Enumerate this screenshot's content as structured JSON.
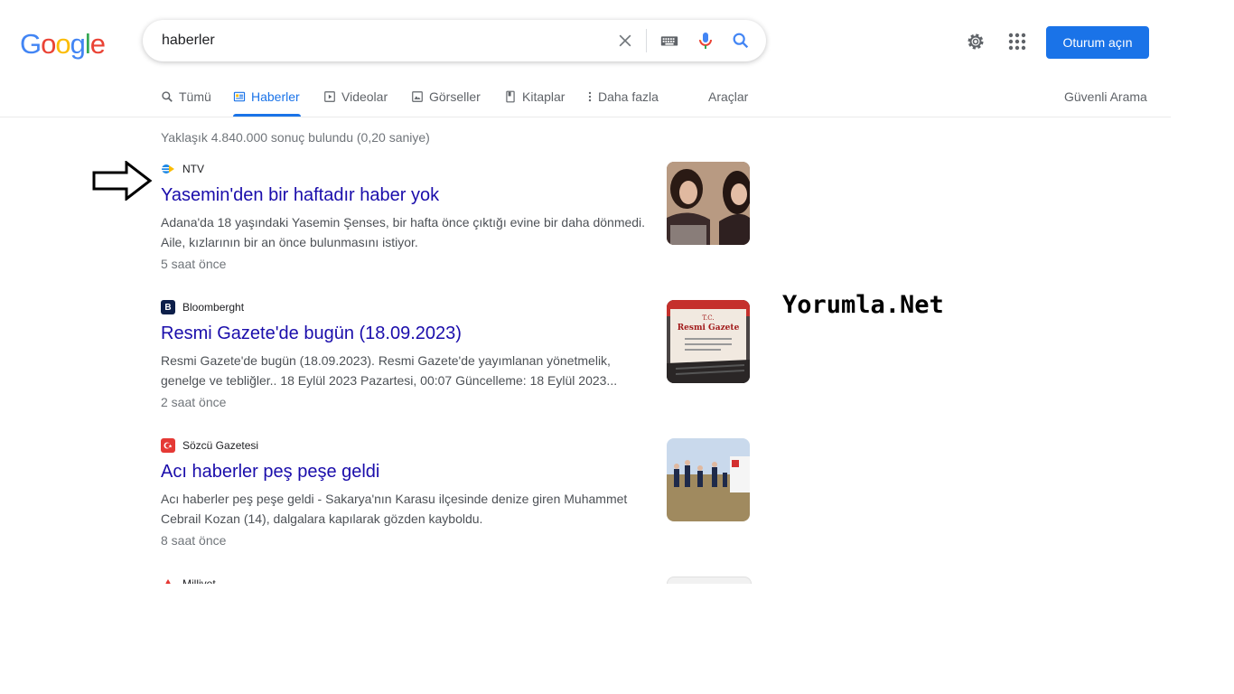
{
  "logo": {
    "letters": [
      "G",
      "o",
      "o",
      "g",
      "l",
      "e"
    ],
    "colors": [
      "#4285f4",
      "#ea4335",
      "#fbbc05",
      "#4285f4",
      "#34a853",
      "#ea4335"
    ]
  },
  "search": {
    "query": "haberler"
  },
  "icons": {
    "clear": "close-icon",
    "keyboard": "keyboard-icon",
    "mic": "mic-icon",
    "search": "search-icon",
    "settings": "gear-icon",
    "apps": "apps-grid-icon",
    "annotation": "arrow-right-outline-icon"
  },
  "header": {
    "signin_label": "Oturum açın"
  },
  "tabs": [
    {
      "label": "Tümü",
      "icon": "search-icon"
    },
    {
      "label": "Haberler",
      "icon": "news-icon",
      "active": true
    },
    {
      "label": "Videolar",
      "icon": "video-icon"
    },
    {
      "label": "Görseller",
      "icon": "image-icon"
    },
    {
      "label": "Kitaplar",
      "icon": "book-icon"
    },
    {
      "label": "Daha fazla",
      "icon": "more-vert-icon"
    }
  ],
  "tools_label": "Araçlar",
  "safesearch_label": "Güvenli Arama",
  "result_stats": "Yaklaşık 4.840.000 sonuç bulundu (0,20 saniye)",
  "results": [
    {
      "source": "NTV",
      "title": "Yasemin'den bir haftadır haber yok",
      "snippet": "Adana'da 18 yaşındaki Yasemin Şenses, bir hafta önce çıktığı evine bir daha dönmedi. Aile, kızlarının bir an önce bulunmasını istiyor.",
      "time": "5 saat önce"
    },
    {
      "source": "Bloomberght",
      "title": "Resmi Gazete'de bugün (18.09.2023)",
      "snippet": "Resmi Gazete'de bugün (18.09.2023). Resmi Gazete'de yayımlanan yönetmelik, genelge ve tebliğler.. 18 Eylül 2023 Pazartesi, 00:07 Güncelleme: 18 Eylül 2023...",
      "time": "2 saat önce"
    },
    {
      "source": "Sözcü Gazetesi",
      "title": "Acı haberler peş peşe geldi",
      "snippet": "Acı haberler peş peşe geldi - Sakarya'nın Karasu ilçesinde denize giren Muhammet Cebrail Kozan (14), dalgalara kapılarak gözden kayboldu.",
      "time": "8 saat önce"
    },
    {
      "source": "Milliyet"
    }
  ],
  "thumb_text": {
    "resmi_line1": "T.C.",
    "resmi_line2": "Resmi Gazete"
  },
  "favicon_text": {
    "bloomberg": "B"
  },
  "watermark": "Yorumla.Net"
}
